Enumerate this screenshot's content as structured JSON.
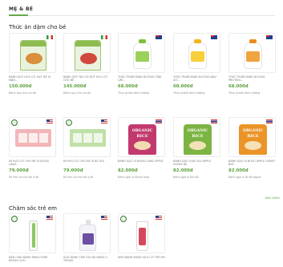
{
  "category": {
    "title": "MẸ & BÉ"
  },
  "sections": [
    {
      "title": "Thức ăn dặm cho bé",
      "products": [
        {
          "name": "BÁNH QUY HỮU CƠ HẠT MỀ VỊ MẬN...",
          "price": "150.000đ",
          "meta": "Bánh quy hữu cơ bé",
          "flag": "italy",
          "image": "cookie-pouch-green"
        },
        {
          "name": "BÁNH QUY TÁO CÀ RỐT HỮU CƠ CHO BÉ",
          "price": "145.000đ",
          "meta": "Bánh quy hữu cơ bé",
          "flag": "italy",
          "image": "cookie-pouch-red"
        },
        {
          "name": "THỨC PHẨM DINH DƯỠNG TRÁI CÂY...",
          "price": "68.000đ",
          "meta": "Thực phẩm dinh dưỡng",
          "flag": "australia",
          "image": "fruit-pouch-green"
        },
        {
          "name": "THỨC PHẨM DINH DƯỠNG ĐẬU XỬ...",
          "price": "68.000đ",
          "meta": "Thực phẩm dinh dưỡng",
          "flag": "australia",
          "image": "fruit-pouch-yellow"
        },
        {
          "name": "THỨC PHẨM DINH DƯỠNG PROTEIN...",
          "price": "68.000đ",
          "meta": "Thực phẩm dinh dưỡng",
          "flag": "australia",
          "image": "fruit-pouch-orange"
        },
        {
          "name": "MÌ HỮU CƠ CHO BÉ VỊ KHOAI LANG",
          "price": "79.000đ",
          "meta": "Mì hữu cơ cho bé vị Bí",
          "flag": "usa",
          "image": "noodle-box-pink"
        },
        {
          "name": "MÌ HỮU CƠ CHO BÉ VỊ BÓ XÔI",
          "price": "79.000đ",
          "meta": "Mì hữu cơ cho bé vị Bí",
          "flag": "usa",
          "image": "noodle-box-green"
        },
        {
          "name": "BÁNH GẠO VỊ KHOAI LANG APPLE",
          "price": "82.000đ",
          "meta": "Bánh gạo vị Khoai lang",
          "flag": "thailand",
          "image": "rice-cracker-pink"
        },
        {
          "name": "BÁNH GẠO VỊ BÓ XÔI APPLE HONEY BE",
          "price": "82.000đ",
          "meta": "Bánh gạo vị Bó xôi",
          "flag": "thailand",
          "image": "rice-cracker-green"
        },
        {
          "name": "BÁNH GẠO VỊ BÍ ĐỎ APPLE HONEY BEE",
          "price": "82.000đ",
          "meta": "Bánh gạo vị Bí đỏ Apple",
          "flag": "thailand",
          "image": "rice-cracker-orange"
        }
      ],
      "view_more": "Xem thêm"
    },
    {
      "title": "Chăm sóc trẻ em",
      "products": [
        {
          "name": "BÀN CHẢI ĐÁNH RĂNG PURE BRUSH CHO",
          "flag": "usa",
          "image": "toothbrush"
        },
        {
          "name": "SỮA BỌNG TẮM GỘI ĐA NĂNG 3 TRONG",
          "flag": "usa",
          "image": "body-wash-bottle"
        },
        {
          "name": "KEM ĐÁNH RĂNG HỮU CƠ TRẺ EM",
          "flag": "usa",
          "image": "toothpaste-tube"
        }
      ]
    }
  ],
  "colors": {
    "accent": "#5da23e",
    "price": "#5da23e",
    "border": "#ececec"
  }
}
